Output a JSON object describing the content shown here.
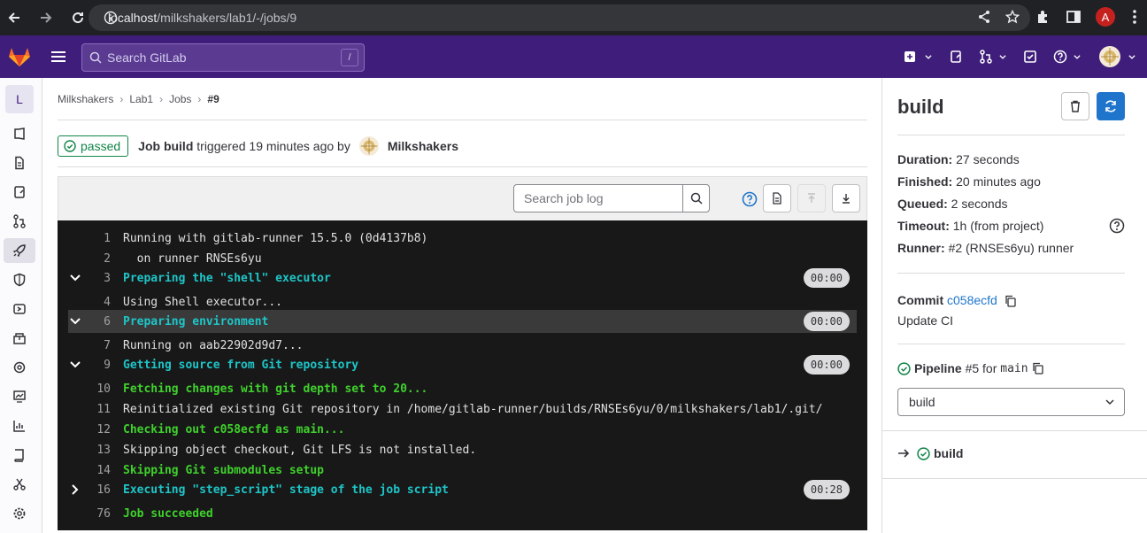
{
  "browser": {
    "url_host": "localhost",
    "url_path": "/milkshakers/lab1/-/jobs/9",
    "profile_initial": "A"
  },
  "header": {
    "search_placeholder": "Search GitLab",
    "search_shortcut": "/"
  },
  "sidebar": {
    "project_initial": "L"
  },
  "breadcrumb": [
    "Milkshakers",
    "Lab1",
    "Jobs",
    "#9"
  ],
  "job_header": {
    "status": "passed",
    "job_word": "Job",
    "job_name": "build",
    "triggered": "triggered 19 minutes ago by",
    "user": "Milkshakers"
  },
  "log_toolbar": {
    "search_placeholder": "Search job log"
  },
  "log": [
    {
      "num": "1",
      "text": "Running with gitlab-runner 15.5.0 (0d4137b8)",
      "style": "plain"
    },
    {
      "num": "2",
      "text": "  on runner RNSEs6yu",
      "style": "plain"
    },
    {
      "num": "3",
      "text": "Preparing the \"shell\" executor",
      "style": "cyan",
      "section": "open",
      "duration": "00:00"
    },
    {
      "num": "4",
      "text": "Using Shell executor...",
      "style": "plain"
    },
    {
      "num": "6",
      "text": "Preparing environment",
      "style": "cyan",
      "section": "open",
      "duration": "00:00",
      "highlight": true
    },
    {
      "num": "7",
      "text": "Running on aab22902d9d7...",
      "style": "plain"
    },
    {
      "num": "9",
      "text": "Getting source from Git repository",
      "style": "cyan",
      "section": "open",
      "duration": "00:00"
    },
    {
      "num": "10",
      "text": "Fetching changes with git depth set to 20...",
      "style": "green"
    },
    {
      "num": "11",
      "text": "Reinitialized existing Git repository in /home/gitlab-runner/builds/RNSEs6yu/0/milkshakers/lab1/.git/",
      "style": "plain"
    },
    {
      "num": "12",
      "text": "Checking out c058ecfd as main...",
      "style": "green"
    },
    {
      "num": "13",
      "text": "Skipping object checkout, Git LFS is not installed.",
      "style": "plain"
    },
    {
      "num": "14",
      "text": "Skipping Git submodules setup",
      "style": "green"
    },
    {
      "num": "16",
      "text": "Executing \"step_script\" stage of the job script",
      "style": "cyan",
      "section": "closed",
      "duration": "00:28"
    },
    {
      "num": "76",
      "text": "Job succeeded",
      "style": "green"
    }
  ],
  "right_panel": {
    "title": "build",
    "duration_label": "Duration:",
    "duration": "27 seconds",
    "finished_label": "Finished:",
    "finished": "20 minutes ago",
    "queued_label": "Queued:",
    "queued": "2 seconds",
    "timeout_label": "Timeout:",
    "timeout": "1h (from project)",
    "runner_label": "Runner:",
    "runner": "#2 (RNSEs6yu) runner",
    "commit_label": "Commit",
    "commit_sha": "c058ecfd",
    "commit_message": "Update CI",
    "pipeline_label": "Pipeline",
    "pipeline_id": "#5",
    "pipeline_for": "for",
    "pipeline_ref": "main",
    "stage_selected": "build",
    "job_name": "build"
  }
}
